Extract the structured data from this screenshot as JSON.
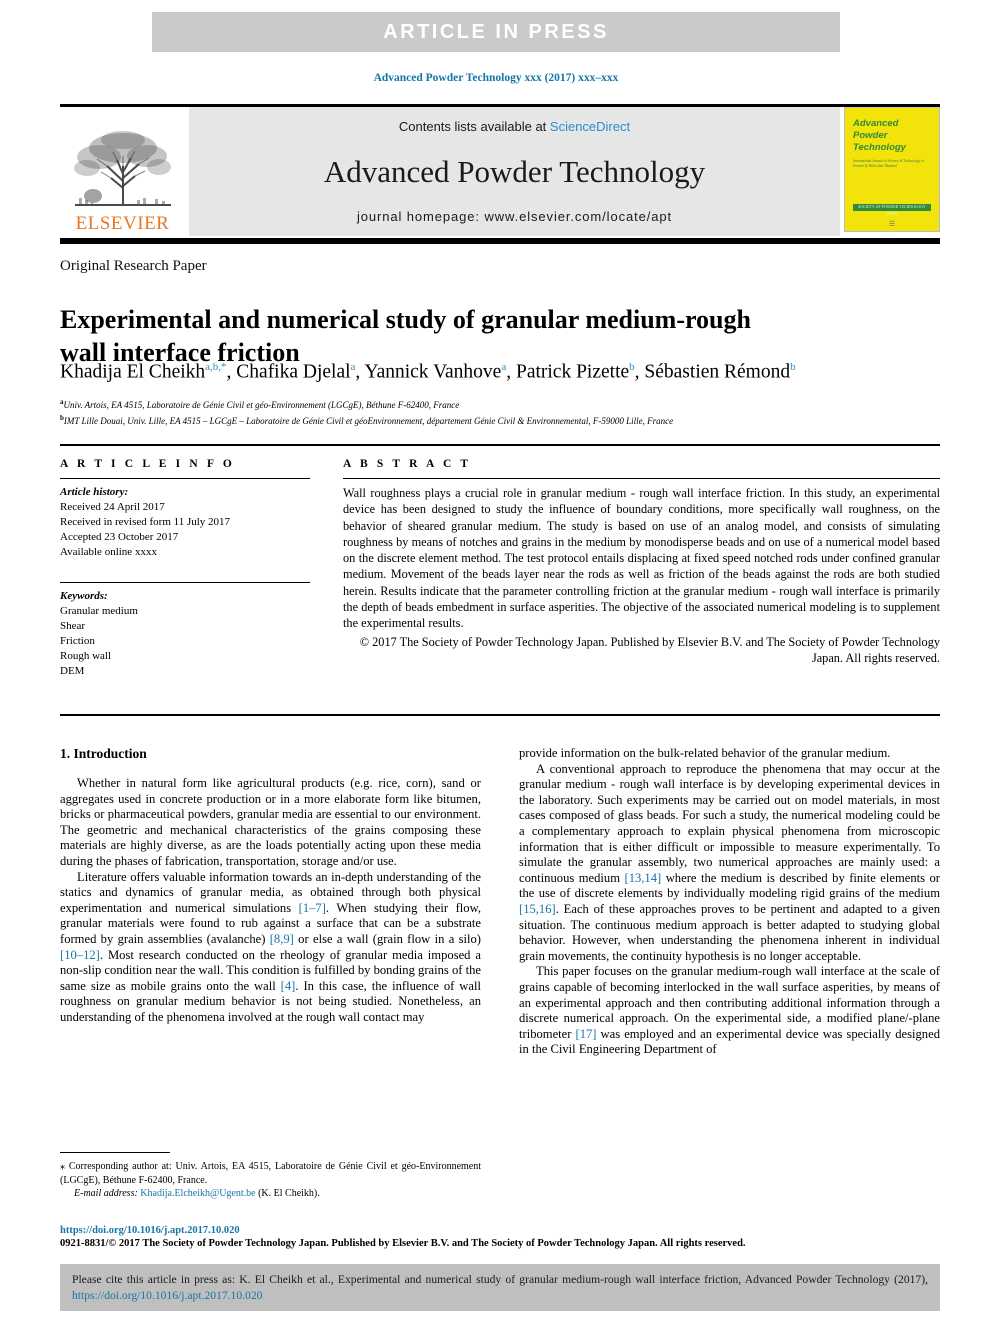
{
  "banner": {
    "label": "ARTICLE  IN  PRESS"
  },
  "running_head": "Advanced Powder Technology xxx (2017) xxx–xxx",
  "masthead": {
    "publisher_name": "ELSEVIER",
    "contents_prefix": "Contents lists available at ",
    "contents_link": "ScienceDirect",
    "journal_name": "Advanced Powder Technology",
    "homepage": "journal homepage: www.elsevier.com/locate/apt",
    "cover": {
      "line1": "Advanced",
      "line2": "Powder",
      "line3": "Technology",
      "subtitle": "International Journal of Science & Technology of Powder & Particulate Material",
      "green_bar_text": "SOCIETY OF POWDER TECHNOLOGY JAPAN",
      "foot_mark": "☰"
    }
  },
  "article": {
    "type": "Original Research Paper",
    "title": "Experimental and numerical study of granular medium-rough wall interface friction",
    "authors": [
      {
        "name": "Khadija El Cheikh",
        "marks": "a,b,*"
      },
      {
        "name": "Chafika Djelal",
        "marks": "a"
      },
      {
        "name": "Yannick Vanhove",
        "marks": "a"
      },
      {
        "name": "Patrick Pizette",
        "marks": "b"
      },
      {
        "name": "Sébastien Rémond",
        "marks": "b"
      }
    ],
    "affiliations": [
      {
        "mark": "a",
        "text": "Univ. Artois, EA 4515, Laboratoire de Génie Civil et géo-Environnement (LGCgE), Béthune F-62400, France"
      },
      {
        "mark": "b",
        "text": "IMT Lille Douai, Univ. Lille, EA 4515 – LGCgE – Laboratoire de Génie Civil et géoEnvironnement, département Génie Civil & Environnemental, F-59000 Lille, France"
      }
    ]
  },
  "info": {
    "heading": "A R T I C L E   I N F O",
    "history_label": "Article history:",
    "history": [
      "Received 24 April 2017",
      "Received in revised form 11 July 2017",
      "Accepted 23 October 2017",
      "Available online xxxx"
    ],
    "keywords_label": "Keywords:",
    "keywords": [
      "Granular medium",
      "Shear",
      "Friction",
      "Rough wall",
      "DEM"
    ]
  },
  "abstract": {
    "heading": "A B S T R A C T",
    "text": "Wall roughness plays a crucial role in granular medium - rough wall interface friction. In this study, an experimental device has been designed to study the influence of boundary conditions, more specifically wall roughness, on the behavior of sheared granular medium. The study is based on use of an analog model, and consists of simulating roughness by means of notches and grains in the medium by monodisperse beads and on use of a numerical model based on the discrete element method. The test protocol entails displacing at fixed speed notched rods under confined granular medium. Movement of the beads layer near the rods as well as friction of the beads against the rods are both studied herein. Results indicate that the parameter controlling friction at the granular medium - rough wall interface is primarily the depth of beads embedment in surface asperities. The objective of the associated numerical modeling is to supplement the experimental results.",
    "copyright": "© 2017 The Society of Powder Technology Japan. Published by Elsevier B.V. and The Society of Powder Technology Japan. All rights reserved."
  },
  "body": {
    "section_title": "1. Introduction",
    "left_paragraphs": [
      {
        "parts": [
          {
            "t": "Whether in natural form like agricultural products (e.g. rice, corn), sand or aggregates used in concrete production or in a more elaborate form like bitumen, bricks or pharmaceutical powders, granular media are essential to our environment. The geometric and mechanical characteristics of the grains composing these materials are highly diverse, as are the loads potentially acting upon these media during the phases of fabrication, transportation, storage and/or use."
          }
        ]
      },
      {
        "parts": [
          {
            "t": "Literature offers valuable information towards an in-depth understanding of the statics and dynamics of granular media, as obtained through both physical experimentation and numerical simulations "
          },
          {
            "t": "[1–7]",
            "ref": true
          },
          {
            "t": ". When studying their flow, granular materials were found to rub against a surface that can be a substrate formed by grain assemblies (avalanche) "
          },
          {
            "t": "[8,9]",
            "ref": true
          },
          {
            "t": " or else a wall (grain flow in a silo) "
          },
          {
            "t": "[10–12]",
            "ref": true
          },
          {
            "t": ". Most research conducted on the rheology of granular media imposed a non-slip condition near the wall. This condition is fulfilled by bonding grains of the same size as mobile grains onto the wall "
          },
          {
            "t": "[4]",
            "ref": true
          },
          {
            "t": ". In this case, the influence of wall roughness on granular medium behavior is not being studied. Nonetheless, an understanding of the phenomena involved at the rough wall contact may"
          }
        ]
      }
    ],
    "right_paragraphs": [
      {
        "noindent": true,
        "parts": [
          {
            "t": "provide information on the bulk-related behavior of the granular medium."
          }
        ]
      },
      {
        "parts": [
          {
            "t": "A conventional approach to reproduce the phenomena that may occur at the granular medium - rough wall interface is by developing experimental devices in the laboratory. Such experiments may be carried out on model materials, in most cases composed of glass beads. For such a study, the numerical modeling could be a complementary approach to explain physical phenomena from microscopic information that is either difficult or impossible to measure experimentally. To simulate the granular assembly, two numerical approaches are mainly used: a continuous medium "
          },
          {
            "t": "[13,14]",
            "ref": true
          },
          {
            "t": " where the medium is described by finite elements or the use of discrete elements by individually modeling rigid grains of the medium "
          },
          {
            "t": "[15,16]",
            "ref": true
          },
          {
            "t": ". Each of these approaches proves to be pertinent and adapted to a given situation. The continuous medium approach is better adapted to studying global behavior. However, when understanding the phenomena inherent in individual grain movements, the continuity hypothesis is no longer acceptable."
          }
        ]
      },
      {
        "parts": [
          {
            "t": "This paper focuses on the granular medium-rough wall interface at the scale of grains capable of becoming interlocked in the wall surface asperities, by means of an experimental approach and then contributing additional information through a discrete numerical approach. On the experimental side, a modified plane/-plane tribometer "
          },
          {
            "t": "[17]",
            "ref": true
          },
          {
            "t": " was employed and an experimental device was specially designed in the Civil Engineering Department of"
          }
        ]
      }
    ]
  },
  "footnote": {
    "star": "⁎",
    "corresponding": " Corresponding author at: Univ. Artois, EA 4515, Laboratoire de Génie Civil et géo-Environnement (LGCgE), Béthune F-62400, France.",
    "email_label": "E-mail address:",
    "email": "Khadija.Elcheikh@Ugent.be",
    "email_suffix": " (K. El Cheikh)."
  },
  "bottom": {
    "doi": "https://doi.org/10.1016/j.apt.2017.10.020",
    "issn_line": "0921-8831/© 2017 The Society of Powder Technology Japan. Published by Elsevier B.V. and The Society of Powder Technology Japan. All rights reserved."
  },
  "cite_box": {
    "prefix": "Please cite this article in press as: K. El Cheikh et al., Experimental and numerical study of granular medium-rough wall interface friction, Advanced Powder Technology (2017), ",
    "link": "https://doi.org/10.1016/j.apt.2017.10.020"
  },
  "colors": {
    "banner_bg": "#c8cacb",
    "link_blue": "#1676a8",
    "sciencedirect_blue": "#2a8ec9",
    "elsevier_orange": "#e87722",
    "cover_yellow": "#f2e40b",
    "cover_green": "#2e8b3a",
    "masthead_gray": "#e6e6e6",
    "cite_gray": "#bfbfbf"
  }
}
